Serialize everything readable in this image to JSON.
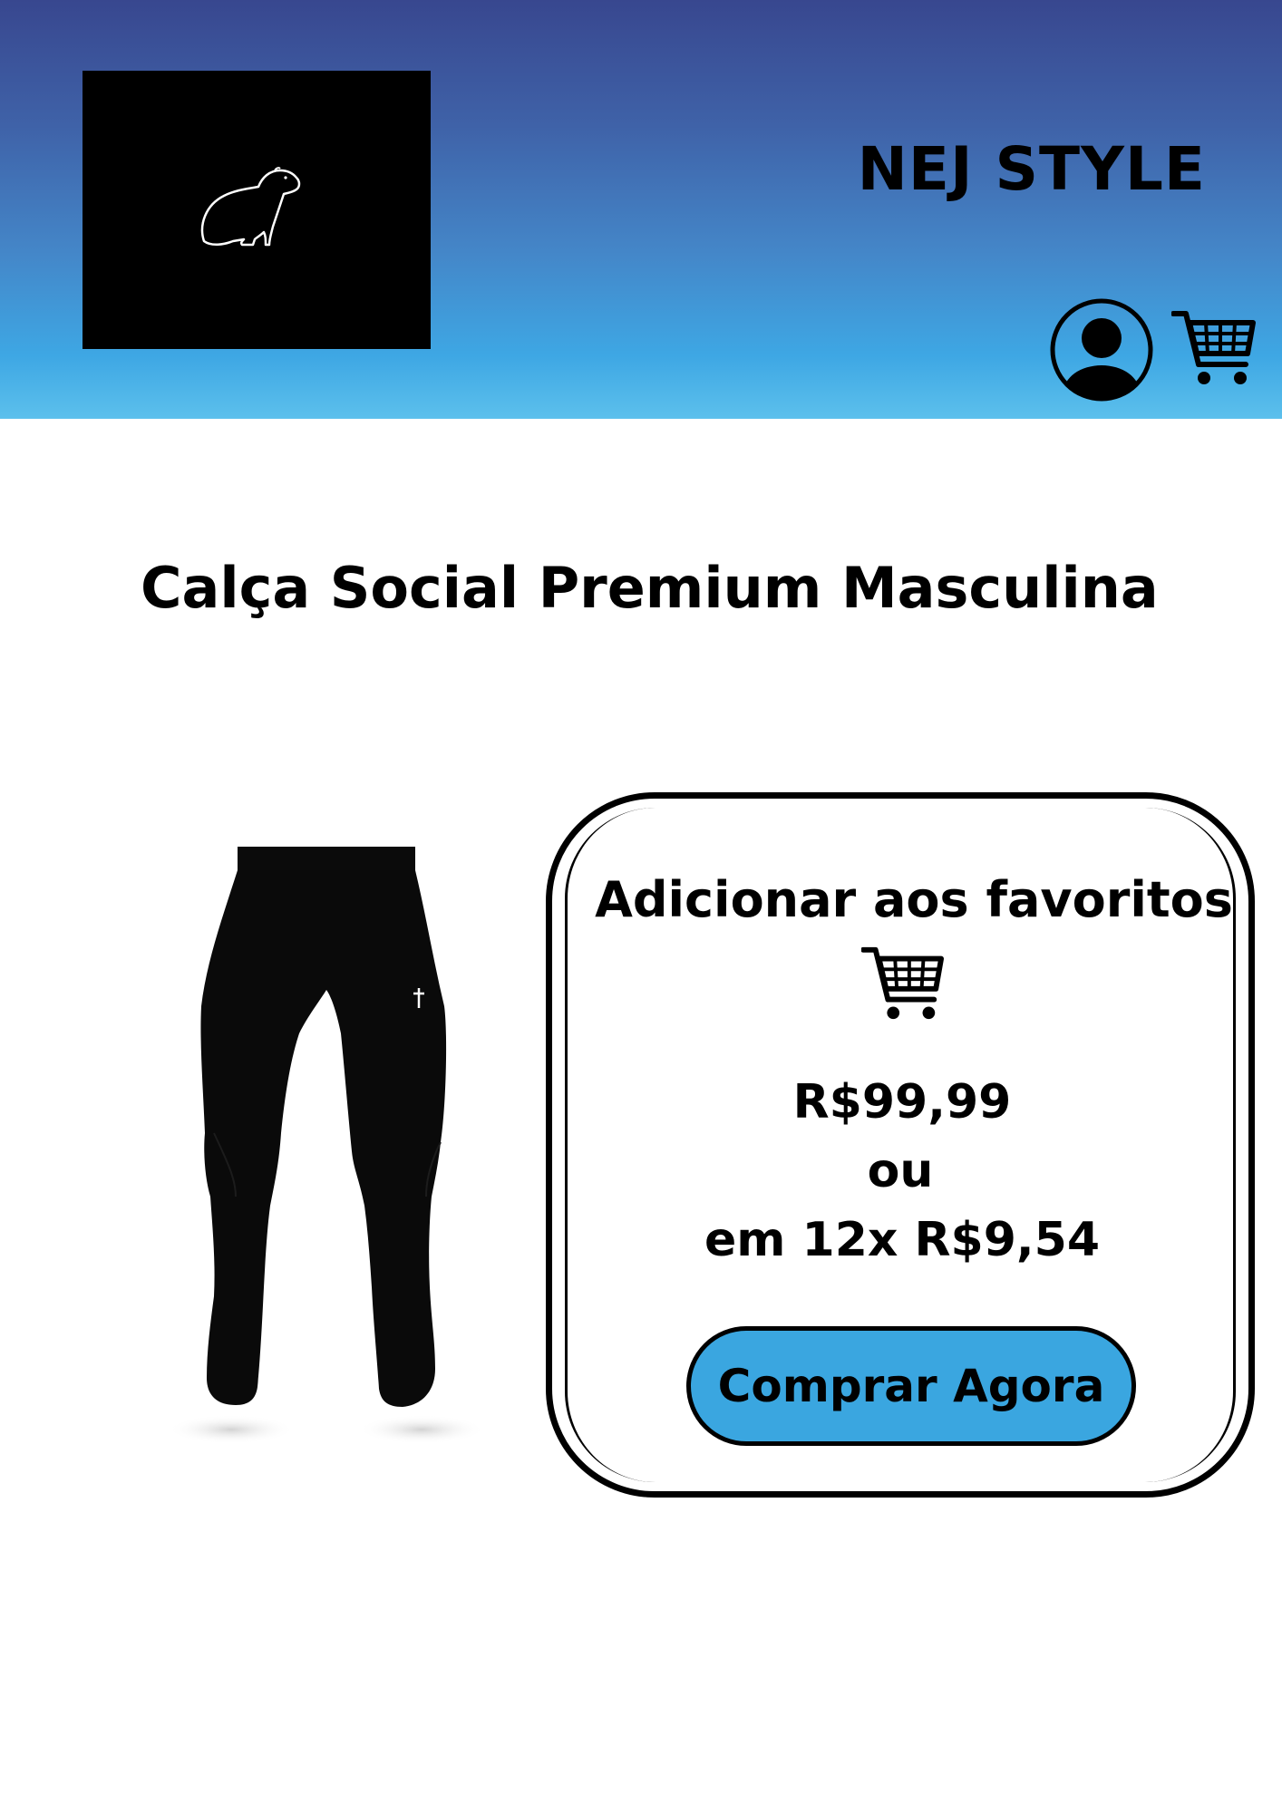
{
  "header": {
    "brand_name": "NEJ STYLE",
    "gradient_colors": [
      "#38478f",
      "#3f62a8",
      "#4486c8",
      "#3ea7e4",
      "#5cc0ec"
    ],
    "logo": {
      "icon": "capybara-outline-icon",
      "background": "#000000",
      "stroke": "#ffffff"
    },
    "actions": [
      {
        "icon": "user-account-icon"
      },
      {
        "icon": "shopping-cart-icon"
      }
    ]
  },
  "product": {
    "title": "Calça Social Premium Masculina",
    "image_icon": "black-jogger-pants-image"
  },
  "purchase_card": {
    "favorite_label": "Adicionar aos favoritos",
    "favorite_icon": "shopping-cart-icon",
    "price": "R$99,99",
    "or_label": "ou",
    "installment": "em 12x R$9,54",
    "buy_button_label": "Comprar Agora",
    "buy_button_color": "#3aa6e0"
  }
}
